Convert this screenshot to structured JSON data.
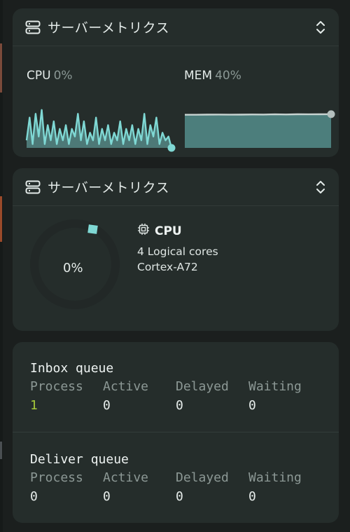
{
  "widgets": {
    "server_metrics_title": "サーバーメトリクス"
  },
  "chart_card": {
    "cpu_label": "CPU",
    "cpu_value": "0%",
    "mem_label": "MEM",
    "mem_value": "40%"
  },
  "chart_data": [
    {
      "type": "line",
      "series": [
        {
          "values": [
            2,
            8,
            1,
            9,
            3,
            10,
            1,
            6,
            2,
            7,
            1,
            5,
            2,
            6,
            1,
            5,
            3,
            9,
            2,
            7,
            1,
            4,
            2,
            8,
            1,
            5,
            2,
            6,
            1,
            4,
            2,
            7,
            1,
            5,
            2,
            6,
            1,
            5,
            2,
            9,
            1,
            6,
            3,
            8,
            1,
            4,
            2,
            3,
            0
          ]
        }
      ]
    },
    {
      "type": "area",
      "series": [
        {
          "values": [
            40,
            40,
            40.2,
            40.3,
            40.1,
            40.2,
            40.4,
            40.3,
            40.5,
            40.4,
            40.6,
            40.5,
            40.6,
            40.7
          ]
        }
      ]
    }
  ],
  "cpu_card": {
    "usage_value": "0%",
    "title": "CPU",
    "cores_text": "4 Logical cores",
    "model_text": "Cortex-A72"
  },
  "queues": {
    "headers": [
      "Process",
      "Active",
      "Delayed",
      "Waiting"
    ],
    "inbox": {
      "title": "Inbox queue",
      "values": [
        "1",
        "0",
        "0",
        "0"
      ]
    },
    "deliver": {
      "title": "Deliver queue",
      "values": [
        "0",
        "0",
        "0",
        "0"
      ]
    }
  },
  "colors": {
    "accent": "#7fd8d4",
    "highlight": "#a6c93a",
    "card_bg": "#252d2b",
    "page_bg": "#1b1f1e"
  }
}
